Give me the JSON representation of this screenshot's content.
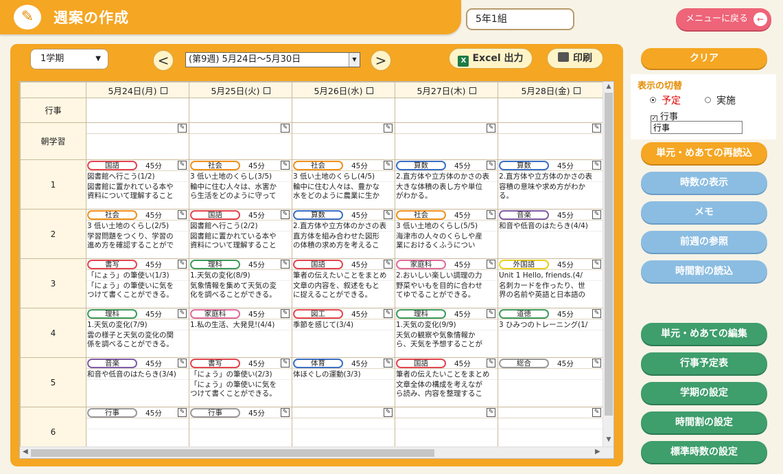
{
  "header": {
    "icon": "notebook-pencil-icon",
    "title": "週案の作成",
    "class_name": "5年1組",
    "back_label": "メニューに戻る"
  },
  "toolbar": {
    "term": "1学期",
    "prev": "<",
    "next": ">",
    "week": "(第9週) 5月24日〜5月30日",
    "excel": "Excel 出力",
    "excel_icon": "X",
    "print": "印刷"
  },
  "days": [
    "5月24日(月)",
    "5月25日(火)",
    "5月26日(水)",
    "5月27日(木)",
    "5月28日(金)"
  ],
  "rows": [
    {
      "label": "行事",
      "type": "event"
    },
    {
      "label": "朝学習",
      "type": "morning"
    },
    {
      "label": "1",
      "type": "period",
      "cells": [
        {
          "subject": "国語",
          "color": "#e2454f",
          "minutes": "45分",
          "unit": "図書館へ行こう(1/2)",
          "detail": "図書館に置かれている本や\n資料について理解すること"
        },
        {
          "subject": "社会",
          "color": "#f0901d",
          "minutes": "45分",
          "unit": "3 低い土地のくらし(3/5)",
          "detail": "輪中に住む人々は、水害か\nら生活をどのように守って"
        },
        {
          "subject": "社会",
          "color": "#f0901d",
          "minutes": "45分",
          "unit": "3 低い土地のくらし(4/5)",
          "detail": "輪中に住む人々は、豊かな\n水をどのように農業に生か"
        },
        {
          "subject": "算数",
          "color": "#3a6fc4",
          "minutes": "45分",
          "unit": "2.直方体や立方体のかさの表",
          "detail": "大きな体積の表し方や単位\nがわかる。"
        },
        {
          "subject": "算数",
          "color": "#3a6fc4",
          "minutes": "45分",
          "unit": "2.直方体や立方体のかさの表",
          "detail": "容積の意味や求め方がわか\nる。"
        }
      ]
    },
    {
      "label": "2",
      "type": "period",
      "cells": [
        {
          "subject": "社会",
          "color": "#f0901d",
          "minutes": "45分",
          "unit": "3 低い土地のくらし(2/5)",
          "detail": "学習問題をつくり、学習の\n進め方を確認することがで"
        },
        {
          "subject": "国語",
          "color": "#e2454f",
          "minutes": "45分",
          "unit": "図書館へ行こう(2/2)",
          "detail": "図書館に置かれている本や\n資料について理解すること"
        },
        {
          "subject": "算数",
          "color": "#3a6fc4",
          "minutes": "45分",
          "unit": "2.直方体や立方体のかさの表",
          "detail": "直方体を組み合わせた図形\nの体積の求め方を考えるこ"
        },
        {
          "subject": "社会",
          "color": "#f0901d",
          "minutes": "45分",
          "unit": "3 低い土地のくらし(5/5)",
          "detail": "海津市の人々のくらしや産\n業におけるくふうについ"
        },
        {
          "subject": "音楽",
          "color": "#7e5ca8",
          "minutes": "45分",
          "unit": "和音や低音のはたらき(4/4)",
          "detail": ""
        }
      ]
    },
    {
      "label": "3",
      "type": "period",
      "cells": [
        {
          "subject": "書写",
          "color": "#e2454f",
          "minutes": "45分",
          "unit": "「にょう」の筆使い(1/3)",
          "detail": "「にょう」の筆使いに気を\nつけて書くことができる。"
        },
        {
          "subject": "理科",
          "color": "#3c9a5a",
          "minutes": "45分",
          "unit": "1.天気の変化(8/9)",
          "detail": "気象情報を集めて天気の変\n化を調べることができる。"
        },
        {
          "subject": "国語",
          "color": "#e2454f",
          "minutes": "45分",
          "unit": "筆者の伝えたいことをまとめ",
          "detail": "文章の内容を、叙述をもと\nに捉えることができる。"
        },
        {
          "subject": "家庭科",
          "color": "#e06a9a",
          "minutes": "45分",
          "unit": "2.おいしい楽しい調理の力",
          "detail": "野菜やいもを目的に合わせ\nてゆでることができる。"
        },
        {
          "subject": "外国語",
          "color": "#e8d020",
          "minutes": "45分",
          "unit": "Unit 1 Hello, friends.(4/",
          "detail": "名刺カードを作ったり、世\n界の名前や英語と日本語の"
        }
      ]
    },
    {
      "label": "4",
      "type": "period",
      "cells": [
        {
          "subject": "理科",
          "color": "#3c9a5a",
          "minutes": "45分",
          "unit": "1.天気の変化(7/9)",
          "detail": "雲の様子と天気の変化の関\n係を調べることができる。"
        },
        {
          "subject": "家庭科",
          "color": "#e06a9a",
          "minutes": "45分",
          "unit": "1.私の生活、大発見!(4/4)",
          "detail": ""
        },
        {
          "subject": "図工",
          "color": "#e2454f",
          "minutes": "45分",
          "unit": "季節を感じて(3/4)",
          "detail": ""
        },
        {
          "subject": "理科",
          "color": "#3c9a5a",
          "minutes": "45分",
          "unit": "1.天気の変化(9/9)",
          "detail": "天気の観察や気象情報か\nら、天気を予想することが"
        },
        {
          "subject": "道徳",
          "color": "#3c9a5a",
          "minutes": "45分",
          "unit": "3 ひみつのトレーニング(1/",
          "detail": ""
        }
      ]
    },
    {
      "label": "5",
      "type": "period",
      "cells": [
        {
          "subject": "音楽",
          "color": "#7e5ca8",
          "minutes": "45分",
          "unit": "和音や低音のはたらき(3/4)",
          "detail": ""
        },
        {
          "subject": "書写",
          "color": "#e2454f",
          "minutes": "45分",
          "unit": "「にょう」の筆使い(2/3)",
          "detail": "「にょう」の筆使いに気を\nつけて書くことができる。"
        },
        {
          "subject": "体育",
          "color": "#3a6fc4",
          "minutes": "45分",
          "unit": "体ほぐしの運動(3/3)",
          "detail": ""
        },
        {
          "subject": "国語",
          "color": "#e2454f",
          "minutes": "45分",
          "unit": "筆者の伝えたいことをまとめ",
          "detail": "文章全体の構成を考えなが\nら読み、内容を整理するこ"
        },
        {
          "subject": "総合",
          "color": "#999999",
          "minutes": "45分",
          "unit": "",
          "detail": ""
        }
      ]
    },
    {
      "label": "6",
      "type": "period",
      "cells": [
        {
          "subject": "行事",
          "color": "#999999",
          "minutes": "45分",
          "unit": "",
          "detail": ""
        },
        {
          "subject": "行事",
          "color": "#999999",
          "minutes": "45分",
          "unit": "",
          "detail": ""
        },
        {
          "subject": "",
          "color": "",
          "minutes": "",
          "unit": "",
          "detail": ""
        },
        {
          "subject": "",
          "color": "",
          "minutes": "",
          "unit": "",
          "detail": ""
        },
        {
          "subject": "",
          "color": "",
          "minutes": "",
          "unit": "",
          "detail": ""
        }
      ]
    }
  ],
  "sidebar": {
    "clear": "クリア",
    "switch_title": "表示の切替",
    "plan": "予定",
    "actual": "実施",
    "event_check": "行事",
    "event_field": "行事",
    "buttons_top": [
      "単元・めあての再読込",
      "時数の表示",
      "メモ",
      "前週の参照",
      "時間割の読込"
    ],
    "buttons_bottom": [
      "単元・めあての編集",
      "行事予定表",
      "学期の設定",
      "時間割の設定",
      "標準時数の設定"
    ]
  },
  "colors": {
    "accent": "#f5a623",
    "plan_label": "#e00000",
    "back_button": "#ee6478",
    "blue_button": "#8bbde2",
    "green_button": "#3e9e6c"
  }
}
